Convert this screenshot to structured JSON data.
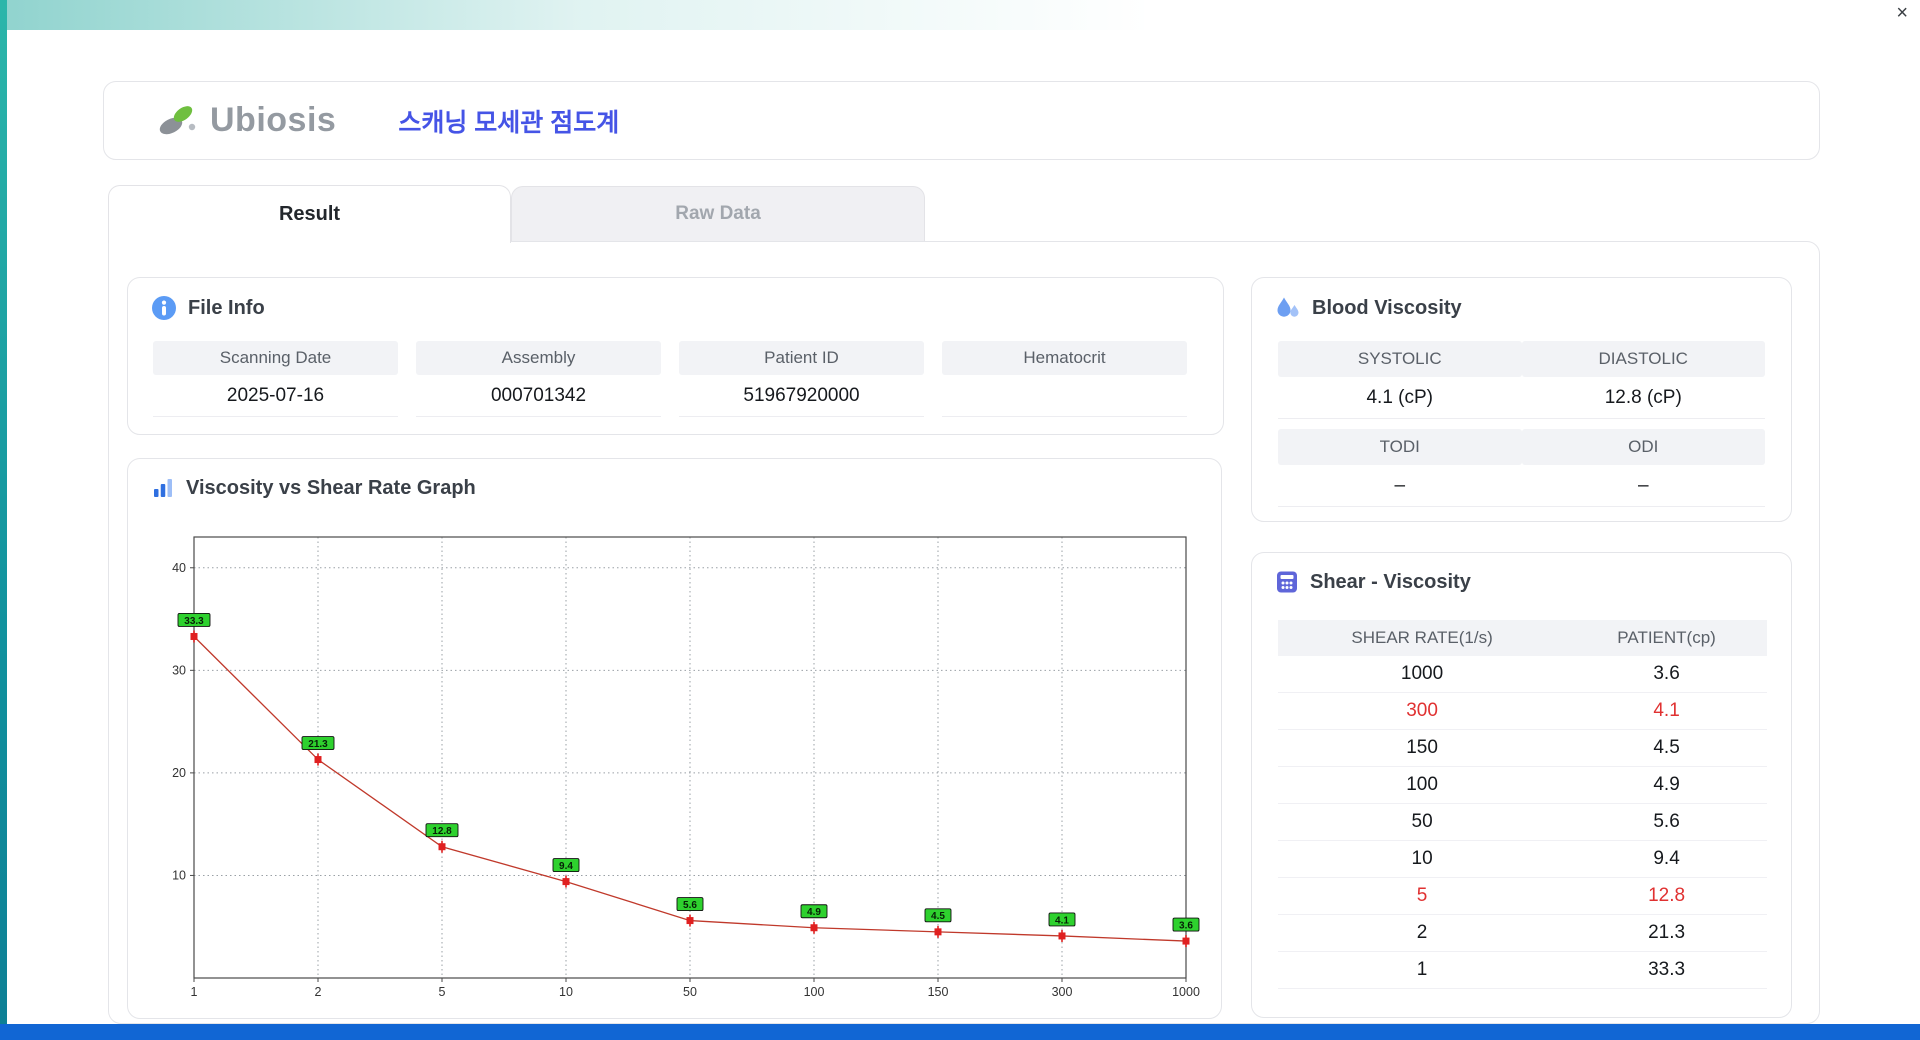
{
  "window": {
    "close": "×"
  },
  "colors": {
    "accent_blue": "#4554e6",
    "taskbar_blue": "#1166d4",
    "edge_teal": "#18b2a8",
    "highlight_red": "#e03131",
    "point_label_green": "#2ed12e"
  },
  "header": {
    "brand": "Ubiosis",
    "app_title": "스캐닝 모세관 점도계"
  },
  "tabs": {
    "result": "Result",
    "raw_data": "Raw Data"
  },
  "file_info": {
    "title": "File Info",
    "fields": [
      {
        "label": "Scanning Date",
        "value": "2025-07-16"
      },
      {
        "label": "Assembly",
        "value": "000701342"
      },
      {
        "label": "Patient ID",
        "value": "51967920000"
      },
      {
        "label": "Hematocrit",
        "value": ""
      }
    ]
  },
  "blood_viscosity": {
    "title": "Blood Viscosity",
    "groups": [
      {
        "h1": "SYSTOLIC",
        "h2": "DIASTOLIC",
        "v1": "4.1 (cP)",
        "v2": "12.8 (cP)"
      },
      {
        "h1": "TODI",
        "h2": "ODI",
        "v1": "–",
        "v2": "–"
      }
    ]
  },
  "shear_viscosity": {
    "title": "Shear - Viscosity",
    "columns": [
      "SHEAR RATE(1/s)",
      "PATIENT(cp)"
    ],
    "rows": [
      {
        "shear_rate": "1000",
        "patient": "3.6",
        "highlight": false
      },
      {
        "shear_rate": "300",
        "patient": "4.1",
        "highlight": true
      },
      {
        "shear_rate": "150",
        "patient": "4.5",
        "highlight": false
      },
      {
        "shear_rate": "100",
        "patient": "4.9",
        "highlight": false
      },
      {
        "shear_rate": "50",
        "patient": "5.6",
        "highlight": false
      },
      {
        "shear_rate": "10",
        "patient": "9.4",
        "highlight": false
      },
      {
        "shear_rate": "5",
        "patient": "12.8",
        "highlight": true
      },
      {
        "shear_rate": "2",
        "patient": "21.3",
        "highlight": false
      },
      {
        "shear_rate": "1",
        "patient": "33.3",
        "highlight": false
      }
    ]
  },
  "chart_data": {
    "type": "line",
    "title": "Viscosity vs Shear Rate Graph",
    "x_scale": "categorical",
    "categories": [
      "1",
      "2",
      "5",
      "10",
      "50",
      "100",
      "150",
      "300",
      "1000"
    ],
    "values": [
      33.3,
      21.3,
      12.8,
      9.4,
      5.6,
      4.9,
      4.5,
      4.1,
      3.6
    ],
    "point_labels": [
      "33.3",
      "21.3",
      "12.8",
      "9.4",
      "5.6",
      "4.9",
      "4.5",
      "4.1",
      "3.6"
    ],
    "xlabel": "",
    "ylabel": "",
    "y_ticks": [
      10,
      20,
      30,
      40
    ],
    "ylim": [
      0,
      43
    ],
    "grid": true,
    "legend": false,
    "line_color": "#c0392b",
    "marker_color": "#e02020",
    "point_label_bg": "#2ed12e"
  }
}
